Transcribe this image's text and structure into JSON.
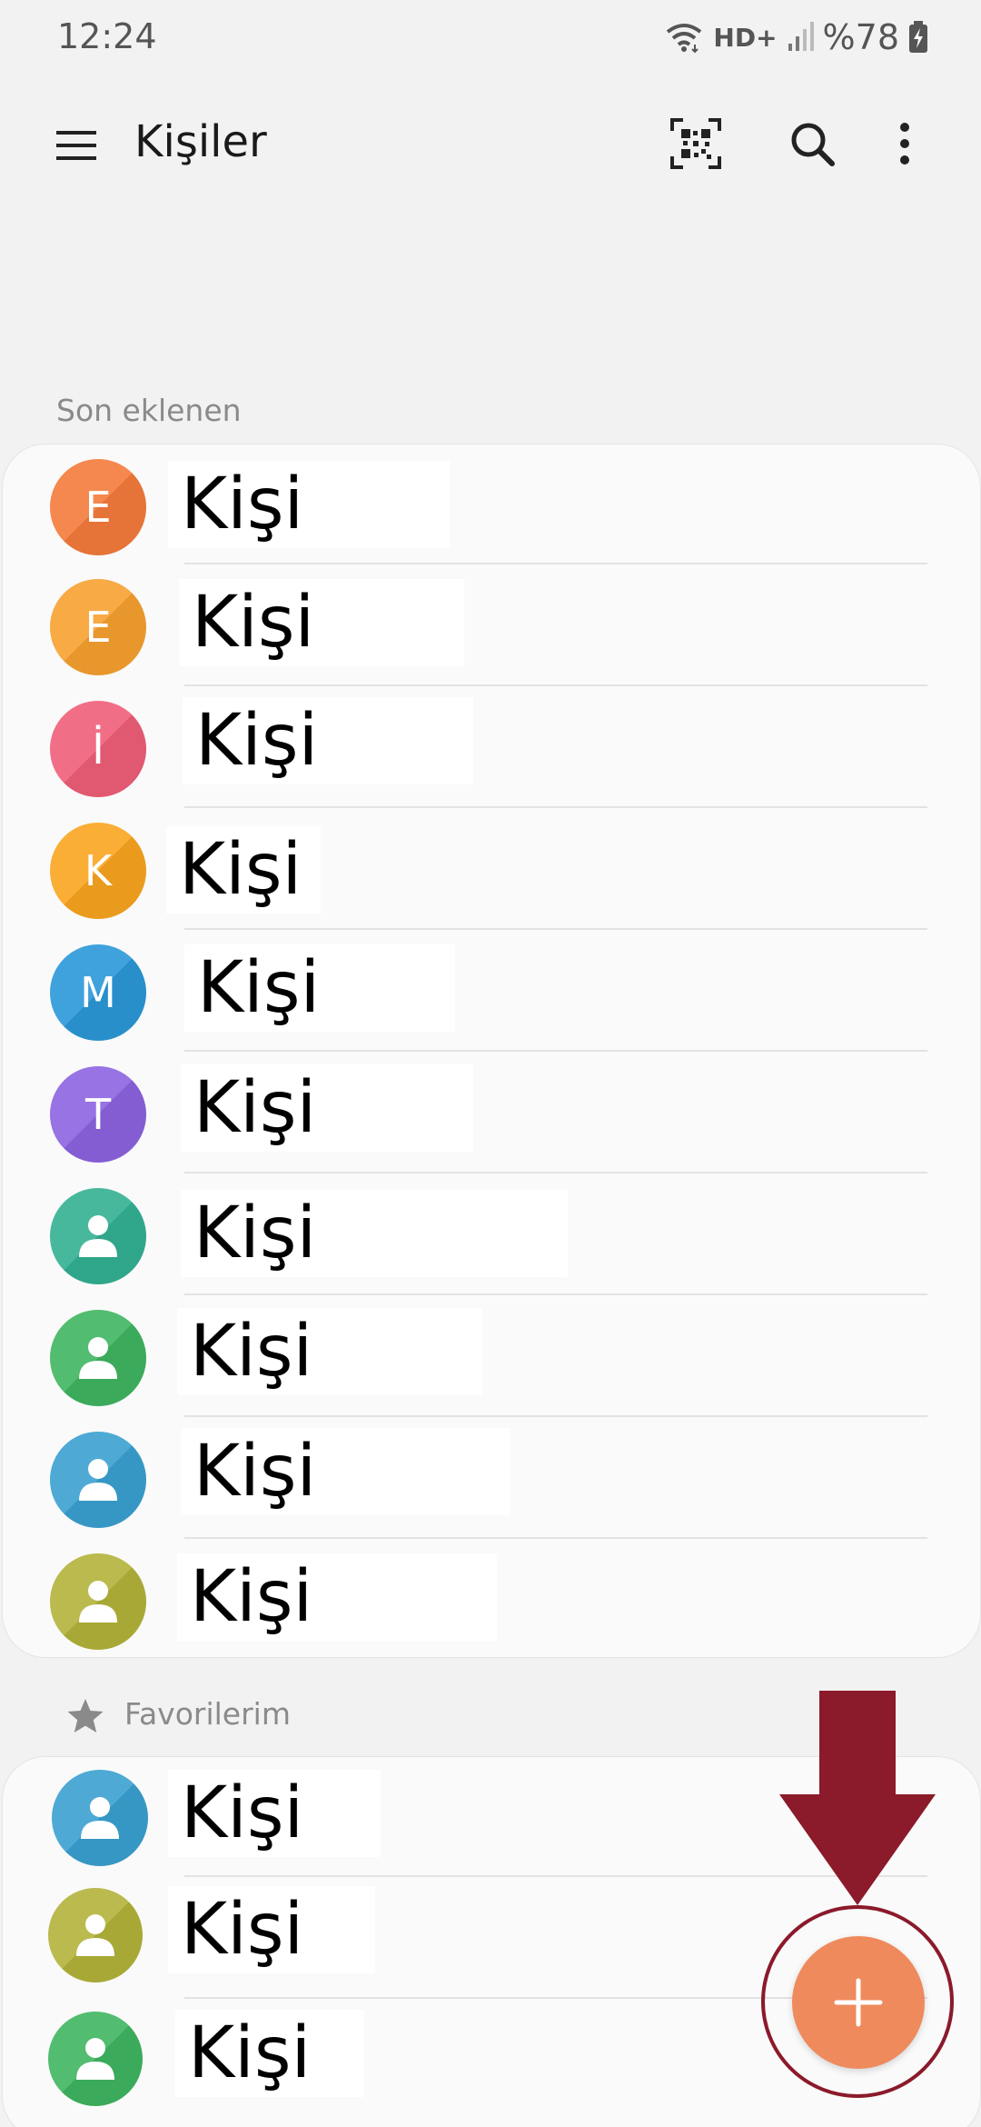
{
  "status_bar": {
    "time": "12:24",
    "network_label": "HD+",
    "battery": "%78"
  },
  "app_bar": {
    "title": "Kişiler",
    "icons": [
      "menu-icon",
      "qr-code-icon",
      "search-icon",
      "more-options-icon"
    ]
  },
  "recent": {
    "label": "Son eklenen",
    "contacts": [
      {
        "initial": "E",
        "name": "Kişi",
        "color": "#f47a3a"
      },
      {
        "initial": "E",
        "name": "Kişi",
        "color": "#f7a030"
      },
      {
        "initial": "İ",
        "name": "Kişi",
        "color": "#ef5e78"
      },
      {
        "initial": "K",
        "name": "Kişi",
        "color": "#f9a51f"
      },
      {
        "initial": "M",
        "name": "Kişi",
        "color": "#2a98d8"
      },
      {
        "initial": "T",
        "name": "Kişi",
        "color": "#8c63e0"
      },
      {
        "initial": "",
        "name": "Kişi",
        "color": "#33b092",
        "icon": "person-icon"
      },
      {
        "initial": "",
        "name": "Kişi",
        "color": "#3fb560",
        "icon": "person-icon"
      },
      {
        "initial": "",
        "name": "Kişi",
        "color": "#3aa0d0",
        "icon": "person-icon"
      },
      {
        "initial": "",
        "name": "Kişi",
        "color": "#b2b23a",
        "icon": "person-icon"
      }
    ]
  },
  "favorites": {
    "label": "Favorilerim",
    "icon": "star-icon",
    "contacts": [
      {
        "initial": "",
        "name": "Kişi",
        "color": "#3aa0d0",
        "icon": "person-icon"
      },
      {
        "initial": "",
        "name": "Kişi",
        "color": "#b2b23a",
        "icon": "person-icon"
      },
      {
        "initial": "",
        "name": "Kişi",
        "color": "#3fb560",
        "icon": "person-icon"
      }
    ]
  },
  "fab": {
    "icon": "plus-icon",
    "color": "#ef8a5c"
  },
  "annotation": {
    "color": "#8b1a2a"
  }
}
